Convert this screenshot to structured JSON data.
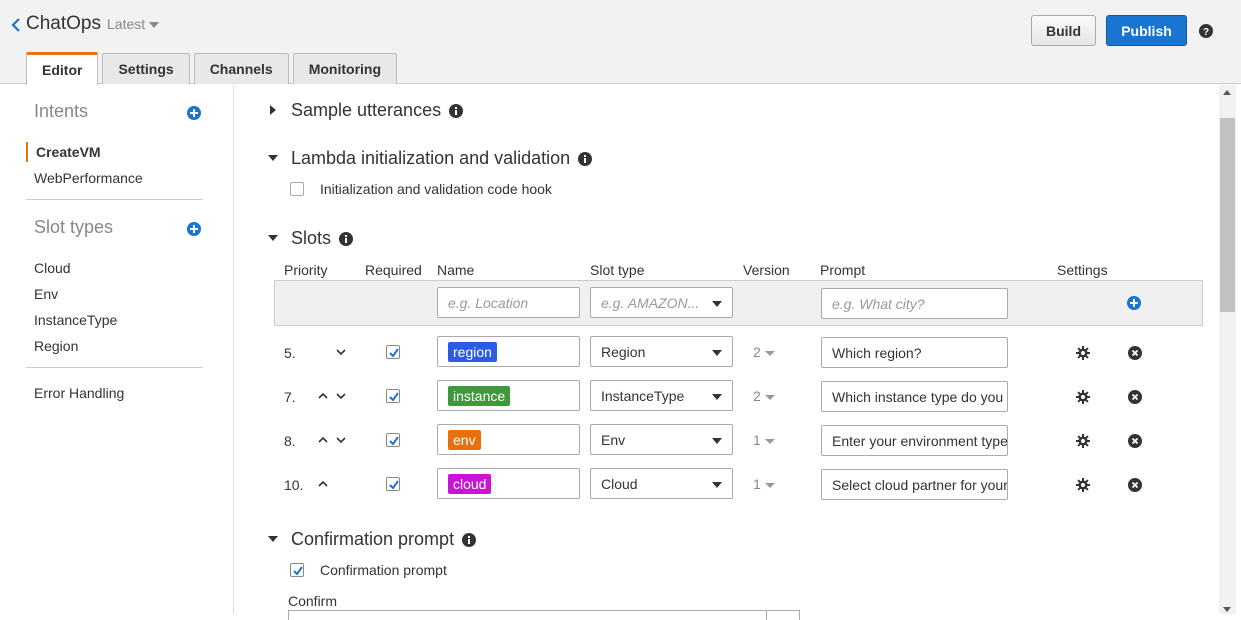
{
  "header": {
    "bot_name": "ChatOps",
    "bot_version": "Latest",
    "build_label": "Build",
    "publish_label": "Publish"
  },
  "tabs": [
    {
      "label": "Editor",
      "active": true
    },
    {
      "label": "Settings",
      "active": false
    },
    {
      "label": "Channels",
      "active": false
    },
    {
      "label": "Monitoring",
      "active": false
    }
  ],
  "sidebar": {
    "intents_heading": "Intents",
    "intents": [
      {
        "label": "CreateVM",
        "active": true
      },
      {
        "label": "WebPerformance",
        "active": false
      }
    ],
    "slot_types_heading": "Slot types",
    "slot_types": [
      "Cloud",
      "Env",
      "InstanceType",
      "Region"
    ],
    "error_handling": "Error Handling"
  },
  "sections": {
    "sample_utterances": "Sample utterances",
    "lambda": "Lambda initialization and validation",
    "lambda_hook_label": "Initialization and validation code hook",
    "slots": "Slots",
    "confirmation": "Confirmation prompt",
    "confirmation_checkbox_label": "Confirmation prompt",
    "confirm_field_label": "Confirm"
  },
  "slots_table": {
    "columns": [
      "Priority",
      "Required",
      "Name",
      "Slot type",
      "Version",
      "Prompt",
      "Settings"
    ],
    "new_row": {
      "name_placeholder": "e.g. Location",
      "slot_type_placeholder": "e.g. AMAZON...",
      "prompt_placeholder": "e.g. What city?"
    },
    "rows": [
      {
        "priority": "5.",
        "name": "region",
        "color": "#2e5be6",
        "slot_type": "Region",
        "version": "2",
        "prompt": "Which region?",
        "required": true
      },
      {
        "priority": "7.",
        "name": "instance",
        "color": "#3c9a3c",
        "slot_type": "InstanceType",
        "version": "2",
        "prompt": "Which instance type do you",
        "required": true
      },
      {
        "priority": "8.",
        "name": "env",
        "color": "#e8700f",
        "slot_type": "Env",
        "version": "1",
        "prompt": "Enter your environment type",
        "required": true
      },
      {
        "priority": "10.",
        "name": "cloud",
        "color": "#c914d6",
        "slot_type": "Cloud",
        "version": "1",
        "prompt": "Select cloud partner for your",
        "required": true
      }
    ]
  },
  "colors": {
    "accent": "#ec7211",
    "primary": "#1a74d1"
  }
}
